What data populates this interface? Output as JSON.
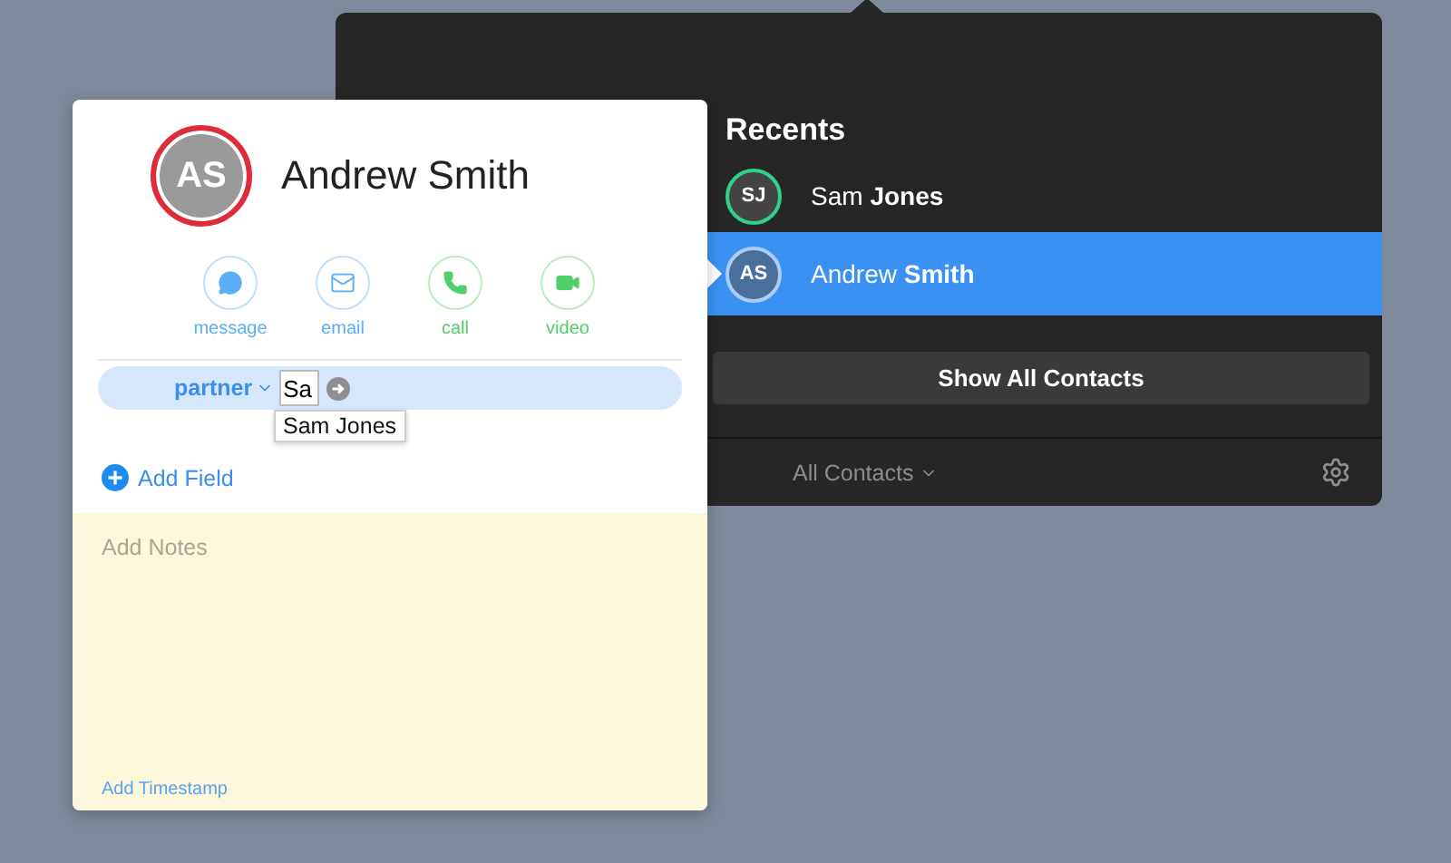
{
  "card": {
    "avatar": {
      "initials": "AS"
    },
    "name": "Andrew Smith",
    "actions": [
      {
        "label": "message",
        "kind": "message",
        "color": "#5aaef5"
      },
      {
        "label": "email",
        "kind": "email",
        "color": "#5aaef5"
      },
      {
        "label": "call",
        "kind": "call",
        "color": "#4fcf6a"
      },
      {
        "label": "video",
        "kind": "video",
        "color": "#4fcf6a"
      }
    ],
    "related_field": {
      "label": "partner",
      "value": "Sa",
      "suggestion": "Sam Jones"
    },
    "add_field": "Add Field",
    "notes": {
      "placeholder": "Add Notes"
    },
    "add_timestamp": "Add Timestamp"
  },
  "popover": {
    "title": "Recents",
    "contacts": [
      {
        "initials": "SJ",
        "name": "Sam **Jones**",
        "selected": false,
        "color": "#2fcf8c"
      },
      {
        "initials": "AS",
        "name": "Andrew **Smith**",
        "selected": true,
        "color": "#a9cdf5"
      }
    ],
    "show_all": "Show All Contacts",
    "group": "All Contacts"
  }
}
